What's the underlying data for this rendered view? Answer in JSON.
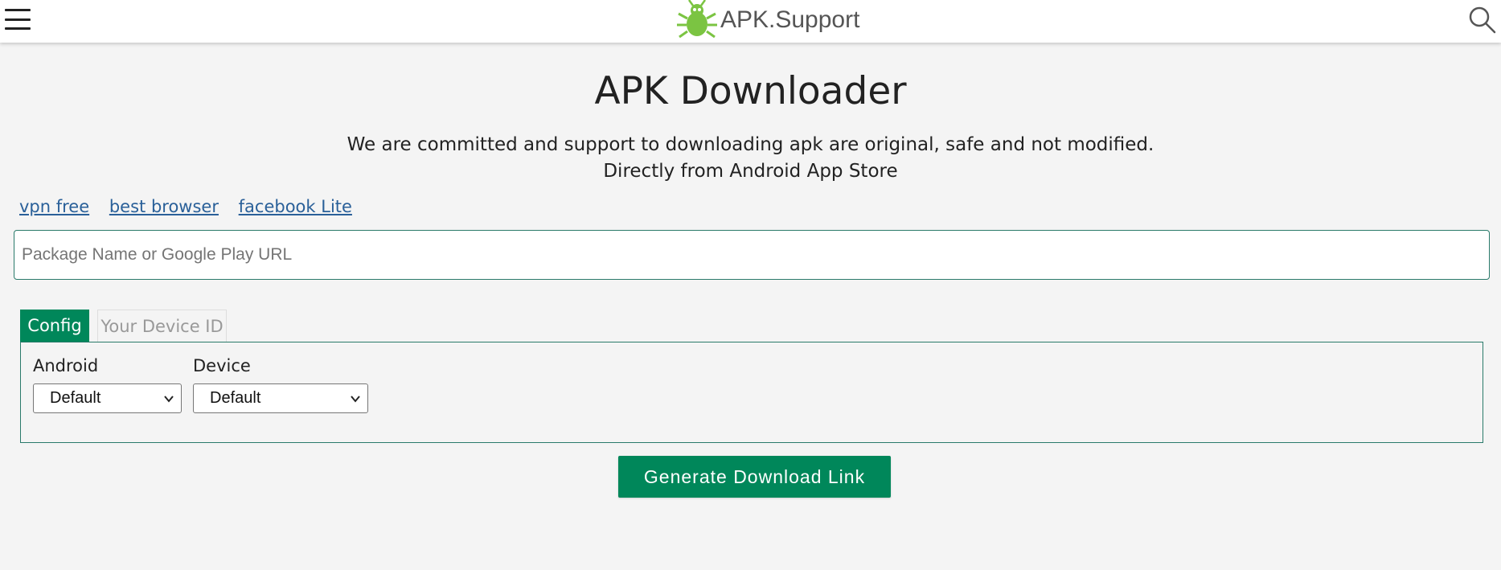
{
  "header": {
    "brand_name": "APK.Support",
    "logo_color": "#7bc442",
    "menu_icon": "hamburger-menu-icon",
    "search_icon": "search-icon"
  },
  "main": {
    "title": "APK Downloader",
    "tagline_line1": "We are committed and support to downloading apk are original, safe and not modified.",
    "tagline_line2": "Directly from Android App Store",
    "quick_links": [
      "vpn free",
      "best browser",
      "facebook Lite"
    ],
    "search": {
      "placeholder": "Package Name or Google Play URL",
      "value": ""
    },
    "tabs": [
      {
        "label": "Config",
        "active": true
      },
      {
        "label": "Your Device ID",
        "active": false
      }
    ],
    "config": {
      "android_label": "Android",
      "android_value": "Default",
      "device_label": "Device",
      "device_value": "Default"
    },
    "generate_label": "Generate Download Link"
  },
  "colors": {
    "accent": "#00875a",
    "link": "#2a6099",
    "background": "#f4f4f4",
    "border": "#2a7a6a"
  }
}
